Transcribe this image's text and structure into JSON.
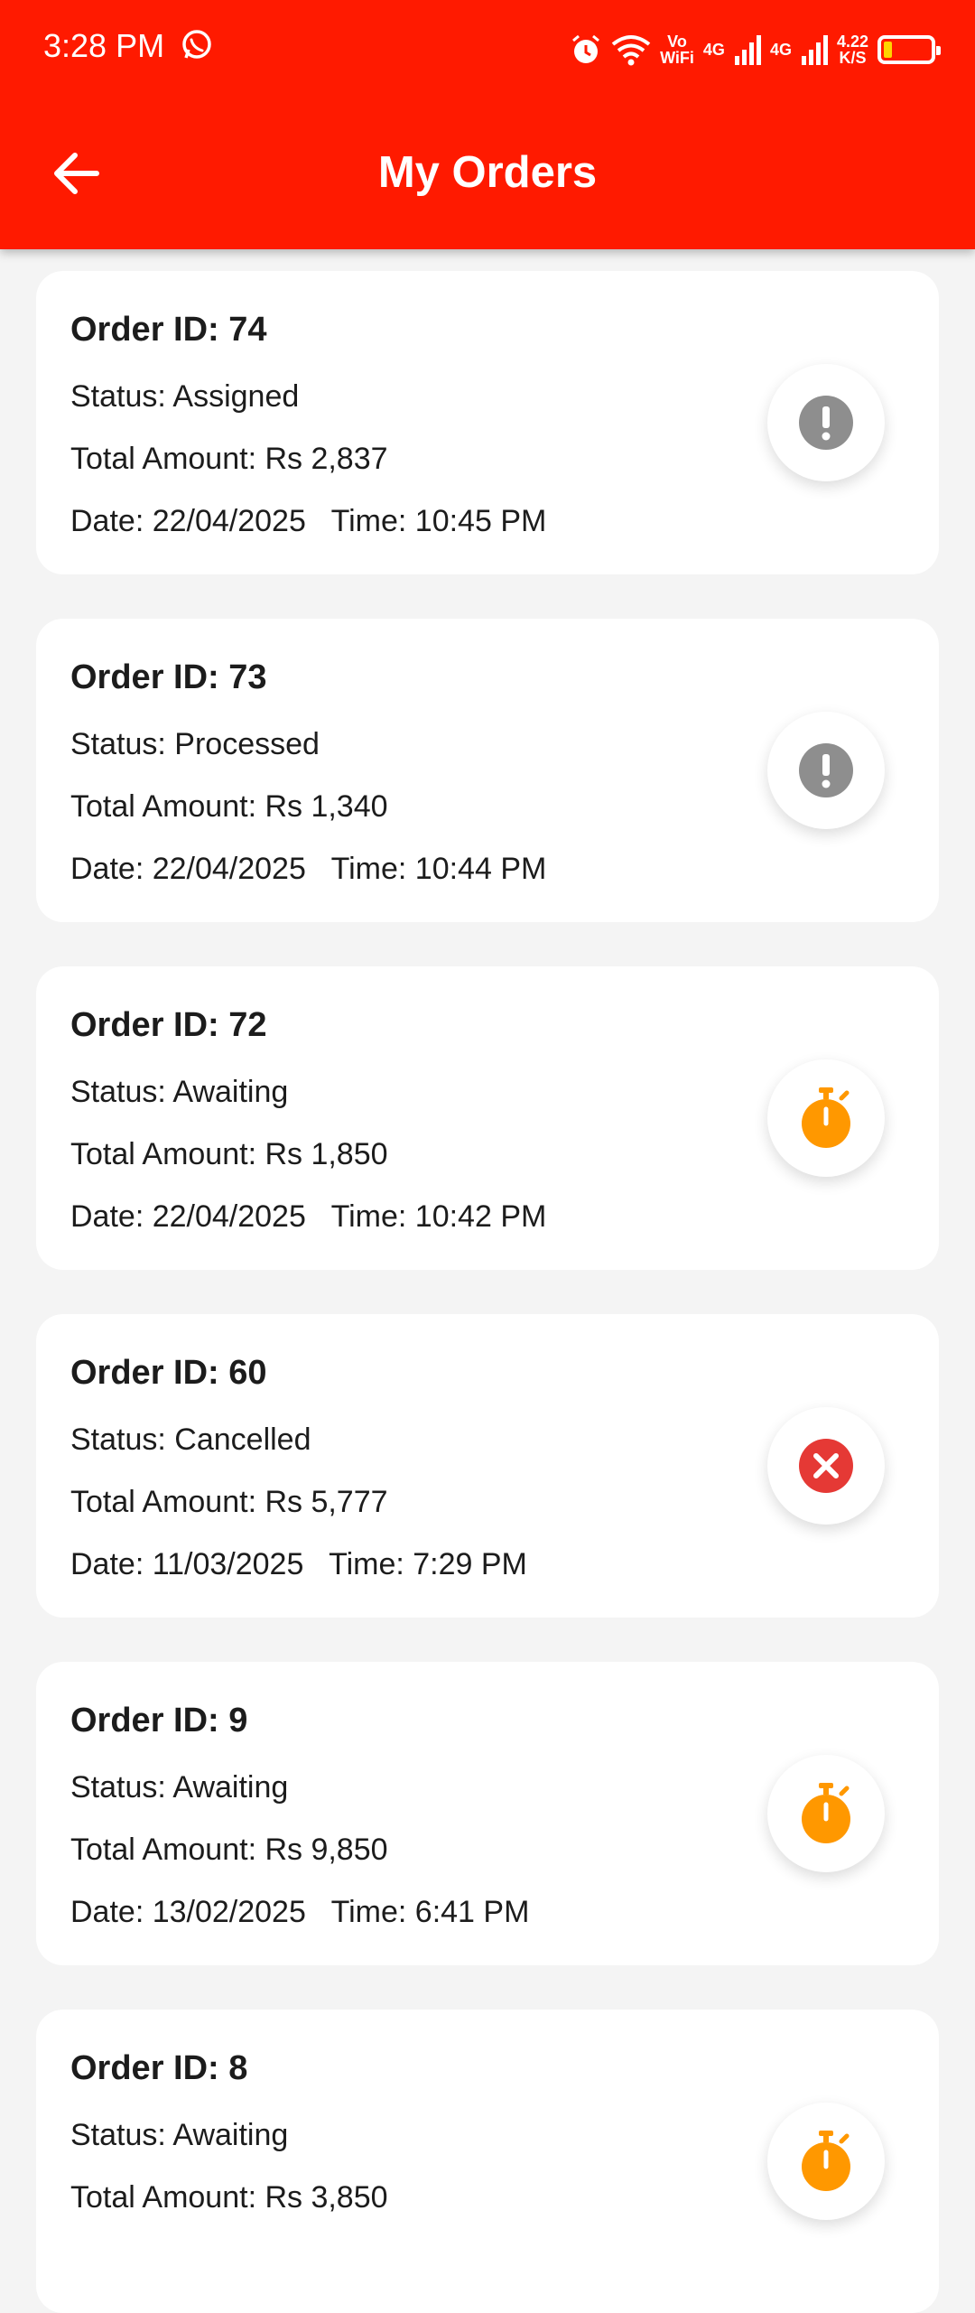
{
  "statusbar": {
    "time": "3:28 PM",
    "vo_label": "Vo",
    "wifi_label": "WiFi",
    "net1": "4G",
    "net2": "4G",
    "speed_value": "4.22",
    "speed_unit": "K/S"
  },
  "header": {
    "title": "My Orders"
  },
  "colors": {
    "accent": "#ff1a00",
    "pending": "#8e8e8e",
    "awaiting": "#ff9800",
    "cancelled": "#e53935"
  },
  "orders": [
    {
      "id_label": "Order ID: 74",
      "status": "Status: Assigned",
      "amount": "Total Amount: Rs 2,837",
      "datetime": "Date: 22/04/2025   Time: 10:45 PM",
      "icon": "exclamation-icon"
    },
    {
      "id_label": "Order ID: 73",
      "status": "Status: Processed",
      "amount": "Total Amount: Rs 1,340",
      "datetime": "Date: 22/04/2025   Time: 10:44 PM",
      "icon": "exclamation-icon"
    },
    {
      "id_label": "Order ID: 72",
      "status": "Status: Awaiting",
      "amount": "Total Amount: Rs 1,850",
      "datetime": "Date: 22/04/2025   Time: 10:42 PM",
      "icon": "stopwatch-icon"
    },
    {
      "id_label": "Order ID: 60",
      "status": "Status: Cancelled",
      "amount": "Total Amount: Rs 5,777",
      "datetime": "Date: 11/03/2025   Time: 7:29 PM",
      "icon": "cancel-icon"
    },
    {
      "id_label": "Order ID: 9",
      "status": "Status: Awaiting",
      "amount": "Total Amount: Rs 9,850",
      "datetime": "Date: 13/02/2025   Time: 6:41 PM",
      "icon": "stopwatch-icon"
    },
    {
      "id_label": "Order ID: 8",
      "status": "Status: Awaiting",
      "amount": "Total Amount: Rs 3,850",
      "datetime": "",
      "icon": "stopwatch-icon"
    }
  ]
}
